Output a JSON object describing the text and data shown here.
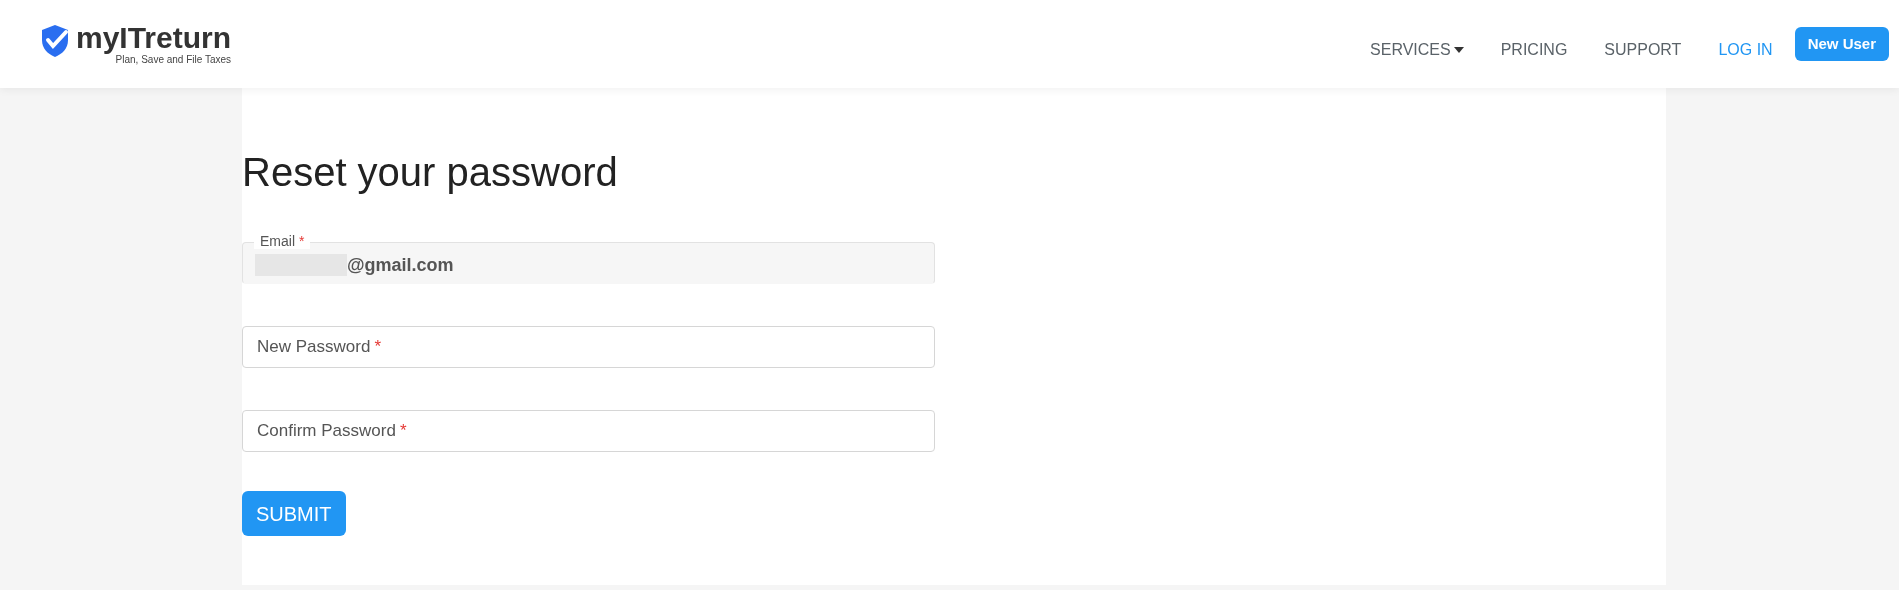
{
  "header": {
    "logo": {
      "name": "myITreturn",
      "tagline": "Plan, Save and File Taxes"
    },
    "nav": [
      {
        "label": "SERVICES",
        "kind": "dropdown"
      },
      {
        "label": "PRICING",
        "kind": "link"
      },
      {
        "label": "SUPPORT",
        "kind": "link"
      },
      {
        "label": "LOG IN",
        "kind": "accent"
      },
      {
        "label": "New User",
        "kind": "button"
      }
    ]
  },
  "form": {
    "title": "Reset your password",
    "fields": [
      {
        "label": "Email",
        "required_mark": "*",
        "value": "@gmail.com",
        "redacted": true,
        "disabled": true
      },
      {
        "label": "New Password",
        "required_mark": "*",
        "disabled": false
      },
      {
        "label": "Confirm Password",
        "required_mark": "*",
        "disabled": false
      }
    ],
    "submit": "SUBMIT"
  }
}
